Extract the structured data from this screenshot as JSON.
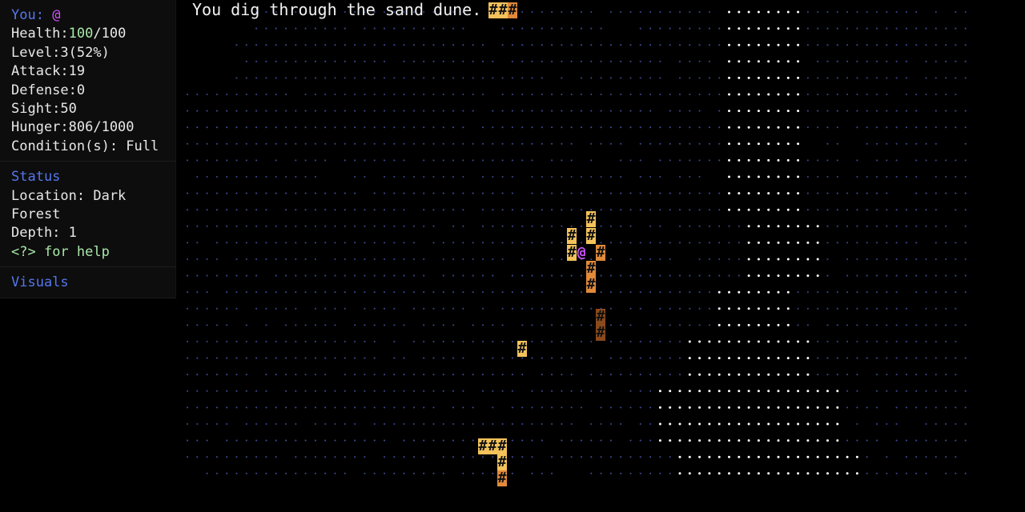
{
  "message": "You dig through the sand dune.",
  "player": {
    "label": "You:",
    "glyph": "@",
    "health_label": "Health:",
    "health_current": "100",
    "health_max": "/100",
    "level": "Level:3(52%)",
    "attack": "Attack:19",
    "defense": "Defense:0",
    "sight": "Sight:50",
    "hunger": "Hunger:806/1000",
    "conditions": "Condition(s): Full"
  },
  "status": {
    "heading": "Status",
    "location_1": "Location: Dark",
    "location_2": "Forest",
    "depth": "Depth: 1",
    "help_key": "<?>",
    "help_text": " for help"
  },
  "visuals": {
    "heading": "Visuals"
  },
  "map": {
    "wall_glyph": "#",
    "floor_glyph": "·",
    "player_glyph": "@",
    "colors": {
      "far_floor": "#3b4a8c",
      "lit_floor": "#ffffff",
      "wall_bright": "#f3c25a",
      "wall_mid": "#e08a3a",
      "wall_dark": "#8a4a1c",
      "player": "#d254ff"
    }
  }
}
